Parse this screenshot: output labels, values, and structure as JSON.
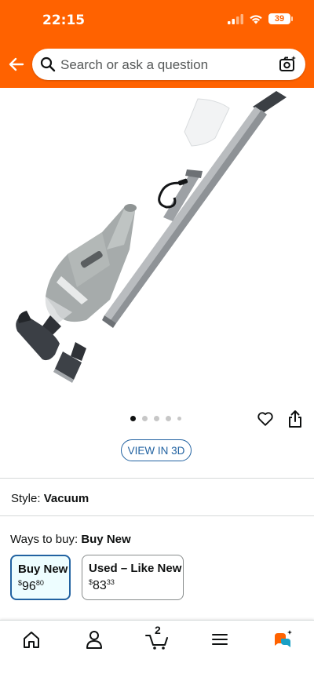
{
  "status": {
    "time": "22:15",
    "battery": "39"
  },
  "search": {
    "placeholder": "Search or ask a question"
  },
  "product": {
    "image_alt": "INTEX handheld pool vacuum with telescoping pole and attachments"
  },
  "gallery": {
    "page_count": 5,
    "current_page": 1
  },
  "view_3d": {
    "label": "VIEW IN 3D"
  },
  "style": {
    "label": "Style:",
    "value": "Vacuum"
  },
  "ways_to_buy": {
    "label": "Ways to buy:",
    "selected": "Buy New",
    "options": [
      {
        "title": "Buy New",
        "currency": "$",
        "whole": "96",
        "fraction": "80"
      },
      {
        "title": "Used – Like New",
        "currency": "$",
        "whole": "83",
        "fraction": "33"
      }
    ]
  },
  "tab_bar": {
    "cart_count": "2"
  },
  "colors": {
    "brand_orange": "#ff6200",
    "link_blue": "#2162a1",
    "selected_bg": "#edfdff"
  }
}
